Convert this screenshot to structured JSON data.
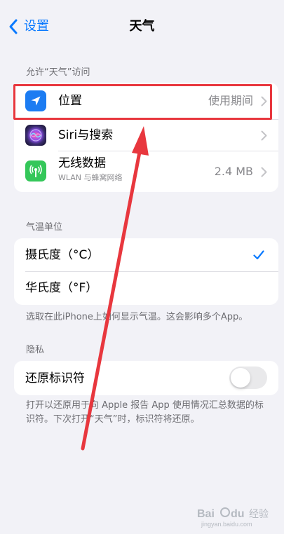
{
  "nav": {
    "back_label": "设置",
    "title": "天气"
  },
  "access_section": {
    "header": "允许“天气”访问",
    "rows": [
      {
        "label": "位置",
        "value": "使用期间",
        "icon": "location-arrow-icon"
      },
      {
        "label": "Siri与搜索",
        "icon": "siri-icon"
      },
      {
        "label": "无线数据",
        "sublabel": "WLAN 与蜂窝网络",
        "value": "2.4 MB",
        "icon": "antenna-icon"
      }
    ]
  },
  "temperature_section": {
    "header": "气温单位",
    "options": [
      {
        "label": "摄氏度（°C）",
        "selected": true
      },
      {
        "label": "华氏度（°F）",
        "selected": false
      }
    ],
    "footer": "选取在此iPhone上如何显示气温。这会影响多个App。"
  },
  "privacy_section": {
    "header": "隐私",
    "toggle_label": "还原标识符",
    "toggle_on": false,
    "footer": "打开以还原用于向 Apple 报告 App 使用情况汇总数据的标识符。下次打开“天气”时，标识符将还原。"
  },
  "colors": {
    "accent": "#0A7AFF",
    "annotation": "#E8373E",
    "background": "#F2F2F7"
  },
  "watermark": {
    "text": "Bai du 经验",
    "url": "jingyan.baidu.com"
  }
}
